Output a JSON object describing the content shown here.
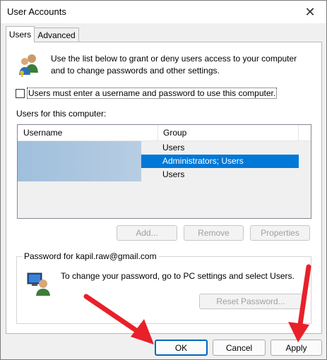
{
  "window": {
    "title": "User Accounts"
  },
  "tabs": [
    {
      "label": "Users"
    },
    {
      "label": "Advanced"
    }
  ],
  "intro": "Use the list below to grant or deny users access to your computer and to change passwords and other settings.",
  "checkbox": {
    "label": "Users must enter a username and password to use this computer.",
    "checked": false
  },
  "users_label": "Users for this computer:",
  "table": {
    "headers": [
      "Username",
      "Group"
    ],
    "rows": [
      {
        "username": "",
        "group": "Users",
        "selected": false
      },
      {
        "username": "",
        "group": "Administrators; Users",
        "selected": true
      },
      {
        "username": "",
        "group": "Users",
        "selected": false
      }
    ]
  },
  "list_buttons": {
    "add": "Add...",
    "remove": "Remove",
    "properties": "Properties"
  },
  "password_group": {
    "legend": "Password for kapil.raw@gmail.com",
    "text": "To change your password, go to PC settings and select Users.",
    "reset": "Reset Password..."
  },
  "footer": {
    "ok": "OK",
    "cancel": "Cancel",
    "apply": "Apply"
  },
  "colors": {
    "selection": "#0078d7",
    "arrow": "#e8202a",
    "focus": "#0067c0"
  },
  "icons": [
    "users-icon",
    "computer-user-icon",
    "close-icon"
  ]
}
